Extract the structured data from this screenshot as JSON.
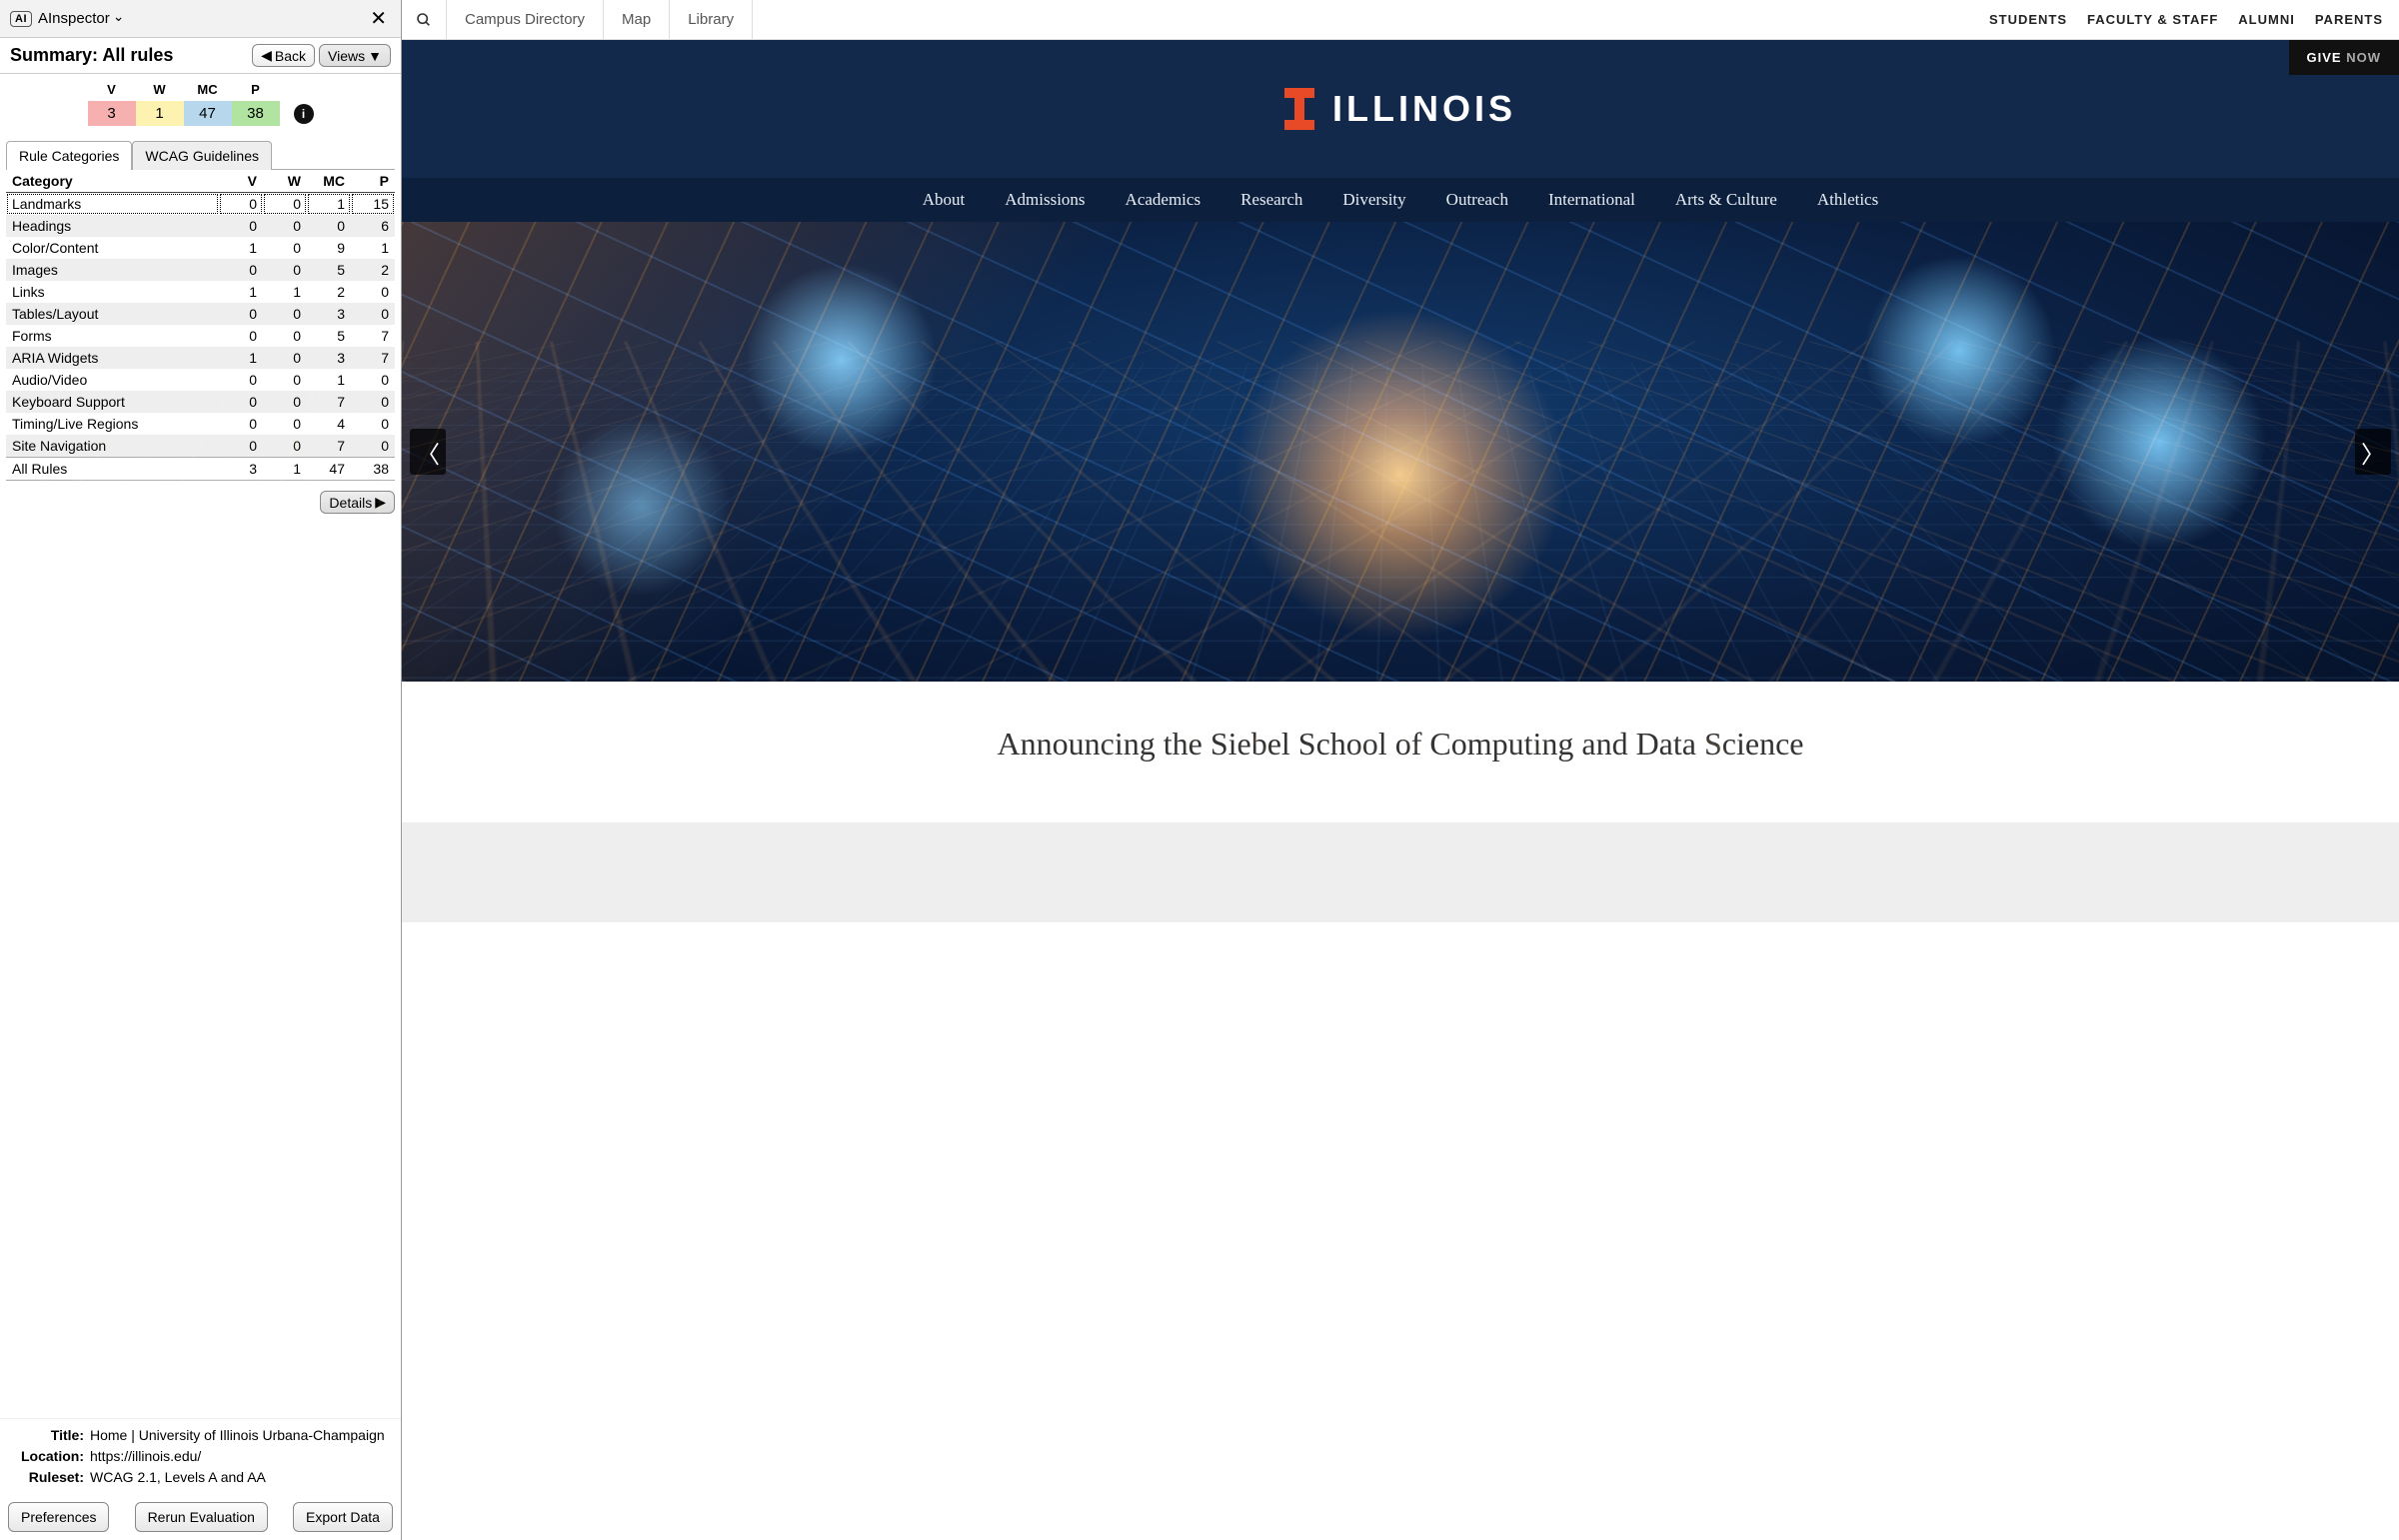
{
  "sidebar": {
    "panel_name": "AInspector",
    "summary_heading": "Summary: All rules",
    "back_label": "Back",
    "views_label": "Views",
    "counts": {
      "headers": {
        "v": "V",
        "w": "W",
        "mc": "MC",
        "p": "P"
      },
      "values": {
        "v": "3",
        "w": "1",
        "mc": "47",
        "p": "38"
      }
    },
    "tabs": {
      "rule_categories": "Rule Categories",
      "wcag_guidelines": "WCAG Guidelines"
    },
    "table": {
      "headers": {
        "category": "Category",
        "v": "V",
        "w": "W",
        "mc": "MC",
        "p": "P"
      },
      "rows": [
        {
          "category": "Landmarks",
          "v": "0",
          "w": "0",
          "mc": "1",
          "p": "15",
          "selected": true
        },
        {
          "category": "Headings",
          "v": "0",
          "w": "0",
          "mc": "0",
          "p": "6"
        },
        {
          "category": "Color/Content",
          "v": "1",
          "w": "0",
          "mc": "9",
          "p": "1"
        },
        {
          "category": "Images",
          "v": "0",
          "w": "0",
          "mc": "5",
          "p": "2"
        },
        {
          "category": "Links",
          "v": "1",
          "w": "1",
          "mc": "2",
          "p": "0"
        },
        {
          "category": "Tables/Layout",
          "v": "0",
          "w": "0",
          "mc": "3",
          "p": "0"
        },
        {
          "category": "Forms",
          "v": "0",
          "w": "0",
          "mc": "5",
          "p": "7"
        },
        {
          "category": "ARIA Widgets",
          "v": "1",
          "w": "0",
          "mc": "3",
          "p": "7"
        },
        {
          "category": "Audio/Video",
          "v": "0",
          "w": "0",
          "mc": "1",
          "p": "0"
        },
        {
          "category": "Keyboard Support",
          "v": "0",
          "w": "0",
          "mc": "7",
          "p": "0"
        },
        {
          "category": "Timing/Live Regions",
          "v": "0",
          "w": "0",
          "mc": "4",
          "p": "0"
        },
        {
          "category": "Site Navigation",
          "v": "0",
          "w": "0",
          "mc": "7",
          "p": "0"
        },
        {
          "category": "All Rules",
          "v": "3",
          "w": "1",
          "mc": "47",
          "p": "38"
        }
      ]
    },
    "details_label": "Details",
    "meta": {
      "title_label": "Title:",
      "title_value": "Home | University of Illinois Urbana-Champaign",
      "location_label": "Location:",
      "location_value": "https://illinois.edu/",
      "ruleset_label": "Ruleset:",
      "ruleset_value": "WCAG 2.1, Levels A and AA"
    },
    "buttons": {
      "preferences": "Preferences",
      "rerun": "Rerun Evaluation",
      "export": "Export Data"
    }
  },
  "page": {
    "utility_links_left": [
      "Campus Directory",
      "Map",
      "Library"
    ],
    "utility_links_right": [
      "STUDENTS",
      "FACULTY & STAFF",
      "ALUMNI",
      "PARENTS"
    ],
    "give_label": "GIVE",
    "give_now": "NOW",
    "brand_word": "ILLINOIS",
    "main_nav": [
      "About",
      "Admissions",
      "Academics",
      "Research",
      "Diversity",
      "Outreach",
      "International",
      "Arts & Culture",
      "Athletics"
    ],
    "hero_headline": "Announcing the Siebel School of Computing and Data Science"
  }
}
